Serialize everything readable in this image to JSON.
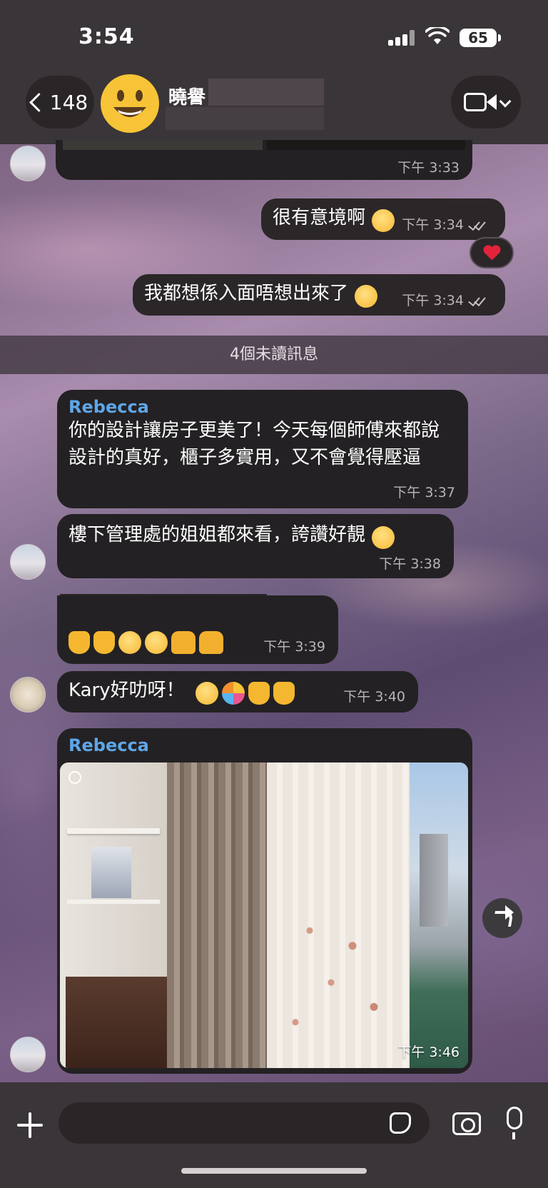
{
  "status_bar": {
    "time": "3:54",
    "battery": "65"
  },
  "header": {
    "back_count": "148",
    "contact_name": "曉譽"
  },
  "messages": [
    {
      "id": "m0",
      "direction": "in",
      "time": "下午 3:33",
      "text": ""
    },
    {
      "id": "m1",
      "direction": "out",
      "text": "很有意境啊",
      "time": "下午 3:34",
      "read": true,
      "reaction": "heart"
    },
    {
      "id": "m2",
      "direction": "out",
      "text": "我都想係入面唔想出來了",
      "time": "下午 3:34",
      "read": true
    },
    {
      "id": "m3",
      "direction": "in",
      "sender": "Rebecca",
      "text": "你的設計讓房子更美了！今天每個師傅來都說設計的真好，櫃子多實用，又不會覺得壓逼",
      "time": "下午 3:37"
    },
    {
      "id": "m4",
      "direction": "in",
      "text": "樓下管理處的姐姐都來看，誇讚好靚",
      "time": "下午 3:38"
    },
    {
      "id": "m5",
      "direction": "in",
      "text": "",
      "time": "下午 3:39",
      "emojis": [
        "thumbs-up",
        "thumbs-up",
        "grin-squint",
        "grin-squint",
        "raising-hands",
        "raising-hands"
      ]
    },
    {
      "id": "m6",
      "direction": "in",
      "text": "Kary好叻呀！",
      "time": "下午 3:40",
      "emojis": [
        "partying-face",
        "party-popper",
        "thumbs-up",
        "thumbs-up"
      ]
    },
    {
      "id": "m7",
      "direction": "in",
      "sender": "Rebecca",
      "type": "photo",
      "time": "下午 3:46"
    }
  ],
  "unread_divider": "4個未讀訊息",
  "composer": {
    "placeholder": ""
  },
  "colors": {
    "sender_name": "#5ea6e8",
    "bubble_bg": "#232123",
    "reaction_heart": "#e2233b",
    "avatar_yellow": "#f7c437"
  },
  "icons": [
    "back-chevron-icon",
    "video-camera-icon",
    "plus-icon",
    "sticker-icon",
    "camera-icon",
    "microphone-icon",
    "forward-icon",
    "heart-icon",
    "wifi-icon",
    "signal-icon",
    "battery-icon"
  ]
}
